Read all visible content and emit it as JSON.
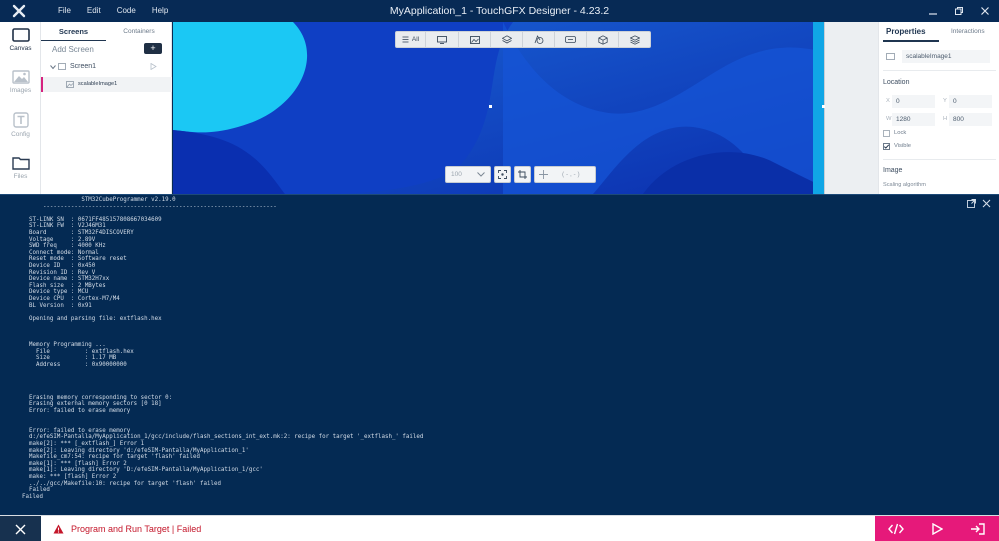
{
  "window": {
    "title": "MyApplication_1 - TouchGFX Designer - 4.23.2",
    "menu": [
      "File",
      "Edit",
      "Code",
      "Help"
    ]
  },
  "rail": {
    "items": [
      {
        "label": "Canvas",
        "icon": "canvas-icon",
        "active": true
      },
      {
        "label": "Images",
        "icon": "images-icon",
        "active": false
      },
      {
        "label": "Config",
        "icon": "config-icon",
        "active": false
      },
      {
        "label": "Files",
        "icon": "folder-icon",
        "active": false
      }
    ]
  },
  "screens_panel": {
    "tabs": [
      "Screens",
      "Containers"
    ],
    "add_screen": "Add Screen",
    "add_button": "+",
    "screen_name": "Screen1",
    "widget_name": "scalableImage1"
  },
  "canvas": {
    "toolbar_all": "All",
    "zoom_value": "100",
    "coord_readout": "( - , - )"
  },
  "properties": {
    "tabs": [
      "Properties",
      "Interactions"
    ],
    "widget_name": "scalableImage1",
    "location_title": "Location",
    "x_label": "X",
    "x_value": "0",
    "y_label": "Y",
    "y_value": "0",
    "w_label": "W",
    "w_value": "1280",
    "h_label": "H",
    "h_value": "800",
    "lock_label": "Lock",
    "visible_label": "Visible",
    "image_title": "Image",
    "scaling_label": "Scaling algorithm"
  },
  "console": {
    "lines": [
      "                 STM32CubeProgrammer v2.19.0",
      "      -------------------------------------------------------------------",
      "",
      "  ST-LINK SN  : 0671FF485157808667034609",
      "  ST-LINK FW  : V2J46M31",
      "  Board       : STM32F4DISCOVERY",
      "  Voltage     : 2.89V",
      "  SWD freq    : 4000 KHz",
      "  Connect mode: Normal",
      "  Reset mode  : Software reset",
      "  Device ID   : 0x450",
      "  Revision ID : Rev V",
      "  Device name : STM32H7xx",
      "  Flash size  : 2 MBytes",
      "  Device type : MCU",
      "  Device CPU  : Cortex-M7/M4",
      "  BL Version  : 0x91",
      "",
      "  Opening and parsing file: extflash.hex",
      "",
      "",
      "",
      "  Memory Programming ...",
      "    File          : extflash.hex",
      "    Size          : 1.17 MB",
      "    Address       : 0x90000000",
      "",
      "",
      "",
      "",
      "  Erasing memory corresponding to sector 0:",
      "  Erasing external memory sectors [0 18]",
      "  Error: failed to erase memory",
      "",
      "",
      "  Error: failed to erase memory",
      "  d:/efeSIM-Pantalla/MyApplication_1/gcc/include/flash_sections_int_ext.mk:2: recipe for target '_extflash_' failed",
      "  make[2]: *** [_extflash_] Error 1",
      "  make[2]: Leaving directory 'd:/efeSIM-Pantalla/MyApplication_1'",
      "  Makefile_cm7:54: recipe for target 'flash' failed",
      "  make[1]: *** [flash] Error 2",
      "  make[1]: Leaving directory 'D:/efeSIM-Pantalla/MyApplication_1/gcc'",
      "  make: *** [flash] Error 2",
      "  ../../gcc/Makefile:10: recipe for target 'flash' failed",
      "  Failed",
      "Failed"
    ]
  },
  "status": {
    "message": "Program and Run Target  |  Failed",
    "color": "#c4162a",
    "accent": "#e6197a"
  }
}
